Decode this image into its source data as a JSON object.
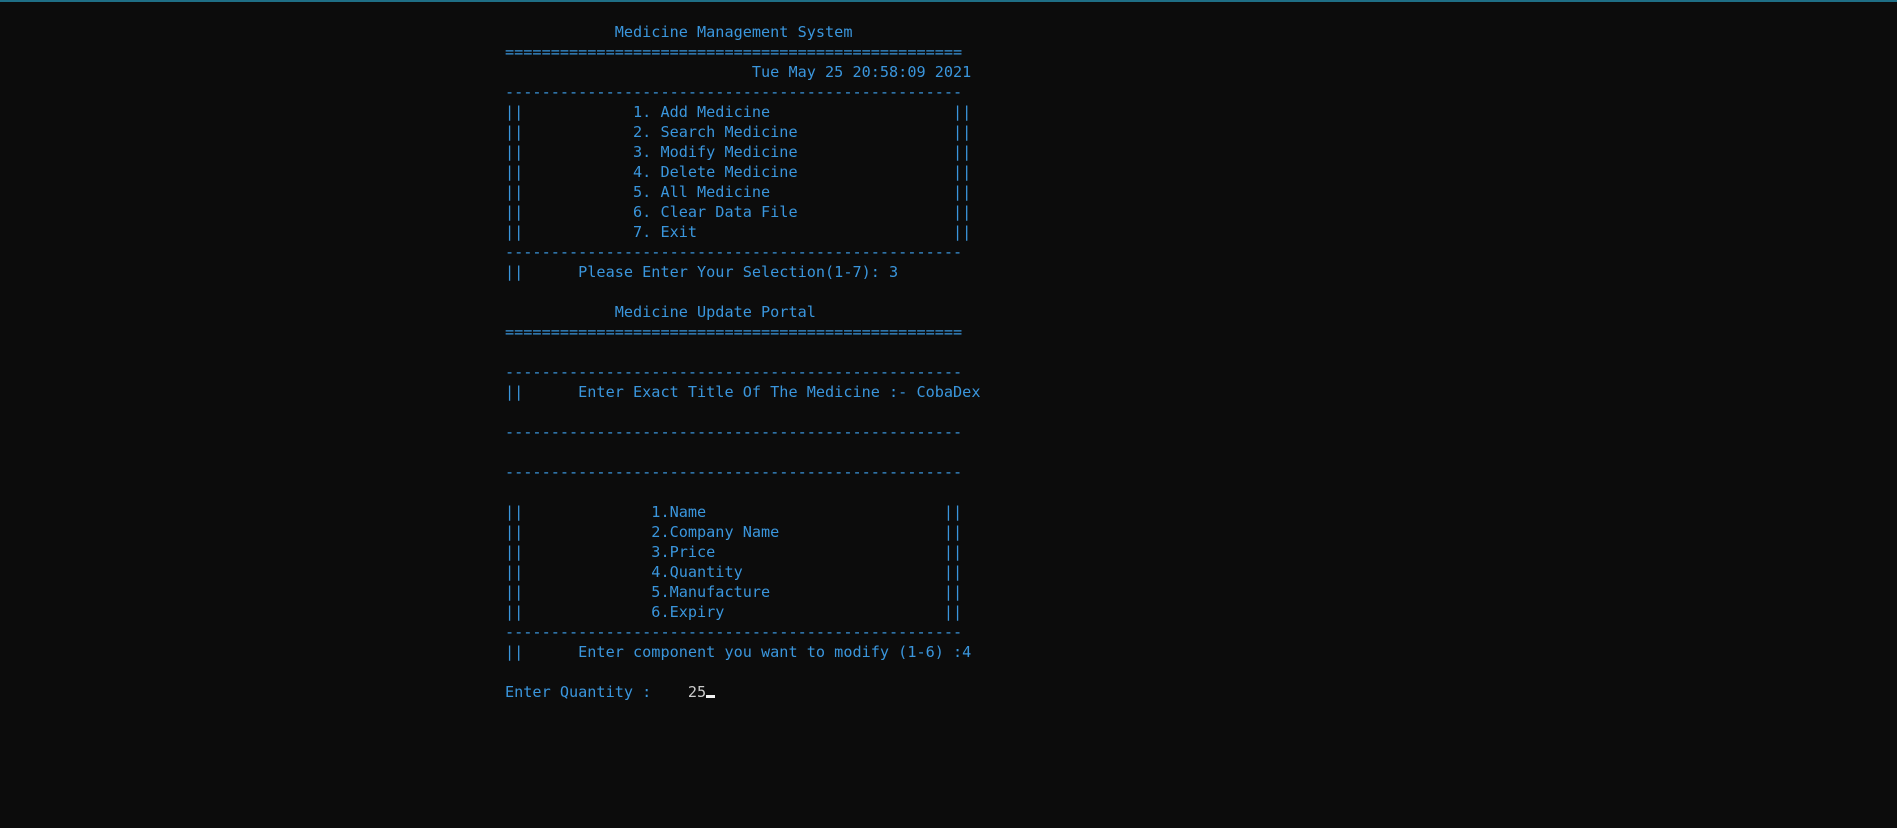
{
  "window": {
    "accent_color": "#1f6f86",
    "background_color": "#0c0c0c",
    "text_color": "#3a96dd"
  },
  "console": {
    "lines": [
      "            Medicine Management System",
      "==================================================",
      "                           Tue May 25 20:58:09 2021",
      "--------------------------------------------------",
      "||            1. Add Medicine                    ||",
      "||            2. Search Medicine                 ||",
      "||            3. Modify Medicine                 ||",
      "||            4. Delete Medicine                 ||",
      "||            5. All Medicine                    ||",
      "||            6. Clear Data File                 ||",
      "||            7. Exit                            ||",
      "--------------------------------------------------",
      "||      Please Enter Your Selection(1-7): 3",
      "",
      "            Medicine Update Portal",
      "==================================================",
      "",
      "--------------------------------------------------",
      "||      Enter Exact Title Of The Medicine :- CobaDex",
      "",
      "--------------------------------------------------",
      "",
      "--------------------------------------------------",
      "",
      "||              1.Name                          ||",
      "||              2.Company Name                  ||",
      "||              3.Price                         ||",
      "||              4.Quantity                      ||",
      "||              5.Manufacture                   ||",
      "||              6.Expiry                        ||",
      "--------------------------------------------------",
      "||      Enter component you want to modify (1-6) :4",
      ""
    ],
    "prompt_label": "Enter Quantity :    ",
    "prompt_value": "25"
  }
}
